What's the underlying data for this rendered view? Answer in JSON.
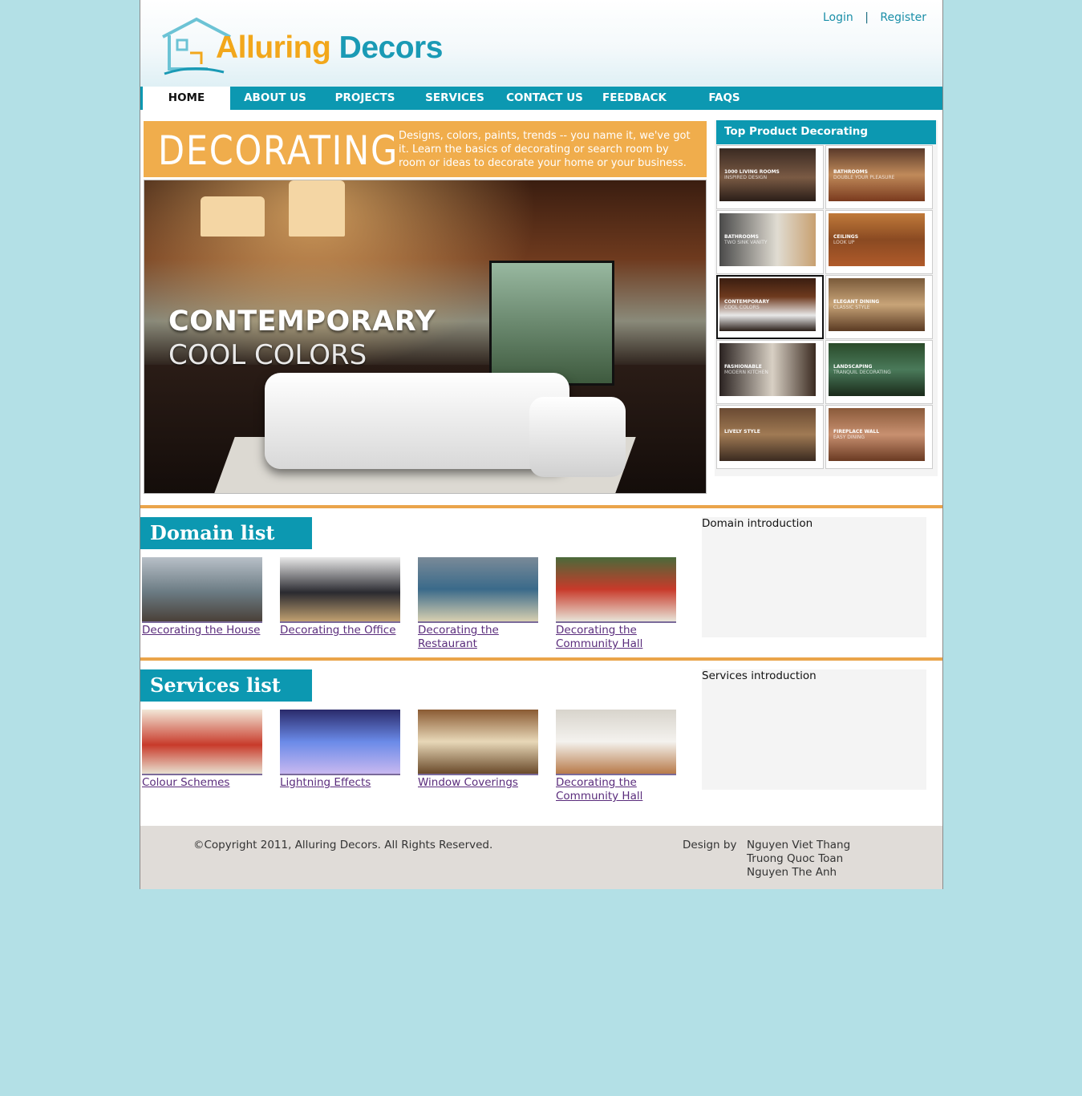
{
  "brand": {
    "part1": "Alluring ",
    "part2": "Decors",
    "accent": "#0c98b1",
    "orange": "#f2a71b",
    "banner_orange": "#f0ad4c"
  },
  "auth": {
    "login": "Login",
    "separator": "|",
    "register": "Register"
  },
  "nav": [
    "HOME",
    "ABOUT US",
    "PROJECTS",
    "SERVICES",
    "CONTACT US",
    "FEEDBACK",
    "FAQS"
  ],
  "banner": {
    "title": "DECORATING",
    "desc": "Designs, colors, paints, trends -- you name it, we've got it. Learn the basics of decorating or search room by room or ideas to decorate your home or your business.",
    "hero_line1": "CONTEMPORARY",
    "hero_line2": "COOL COLORS"
  },
  "sidebar": {
    "title": "Top Product Decorating",
    "thumbs": [
      {
        "cap1": "1000 LIVING ROOMS",
        "cap2": "INSPIRED DESIGN"
      },
      {
        "cap1": "BATHROOMS",
        "cap2": "DOUBLE YOUR PLEASURE"
      },
      {
        "cap1": "BATHROOMS",
        "cap2": "TWO SINK VANITY"
      },
      {
        "cap1": "CEILINGS",
        "cap2": "LOOK UP"
      },
      {
        "cap1": "CONTEMPORARY",
        "cap2": "COOL COLORS"
      },
      {
        "cap1": "ELEGANT DINING",
        "cap2": "CLASSIC STYLE"
      },
      {
        "cap1": "FASHIONABLE",
        "cap2": "MODERN KITCHEN"
      },
      {
        "cap1": "LANDSCAPING",
        "cap2": "TRANQUIL DECORATING"
      },
      {
        "cap1": "LIVELY STYLE",
        "cap2": ""
      },
      {
        "cap1": "FIREPLACE WALL",
        "cap2": "EASY DINING"
      }
    ]
  },
  "domain": {
    "title": "Domain list",
    "items": [
      "Decorating the House",
      "Decorating the Office",
      "Decorating the Restaurant",
      "Decorating the Community Hall"
    ],
    "intro": "Domain introduction"
  },
  "services": {
    "title": "Services list",
    "items": [
      "Colour Schemes",
      "Lightning Effects",
      "Window Coverings",
      "Decorating the Community Hall"
    ],
    "intro": "Services introduction"
  },
  "footer": {
    "copyright": "©Copyright 2011, Alluring Decors. All Rights Reserved.",
    "design_by": "Design by",
    "designers": [
      "Nguyen Viet Thang",
      "Truong Quoc Toan",
      "Nguyen The Anh"
    ]
  }
}
